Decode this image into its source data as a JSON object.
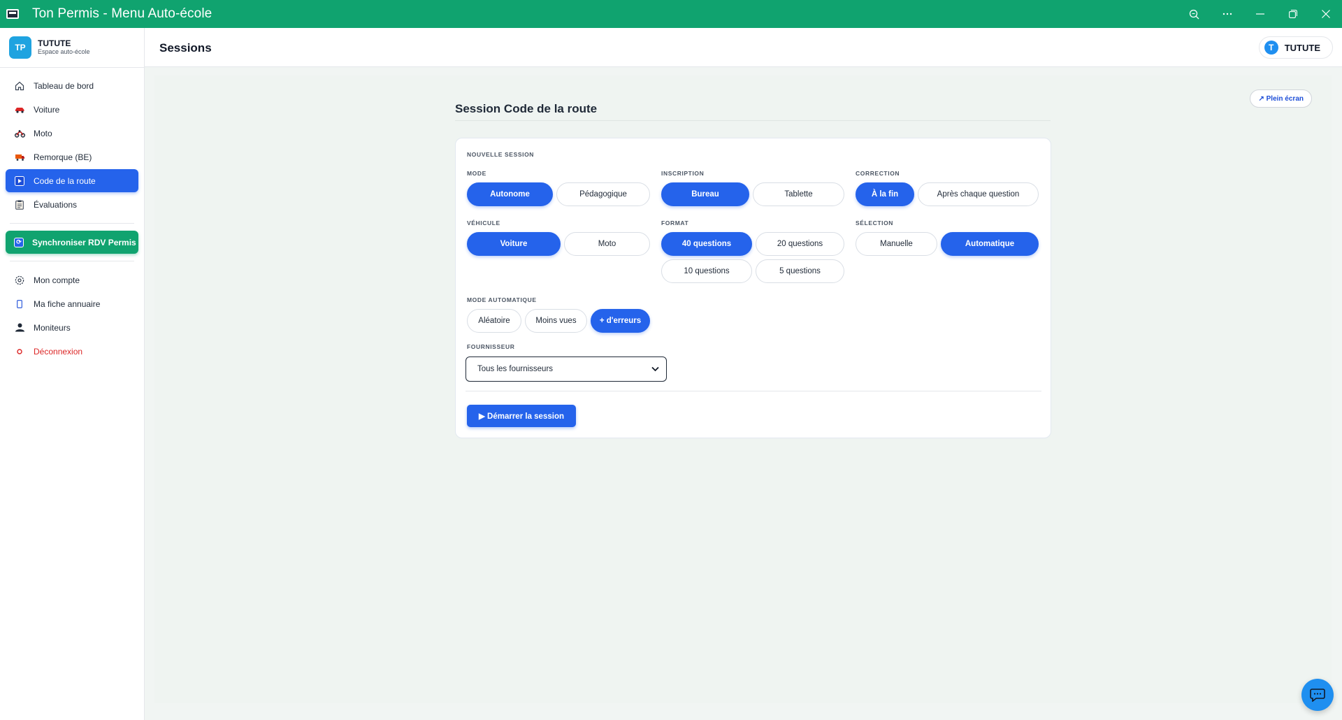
{
  "window": {
    "title": "Ton Permis - Menu Auto-école",
    "controls": [
      "search-icon",
      "more-icon",
      "minimize-icon",
      "restore-icon",
      "close-icon"
    ]
  },
  "brand": {
    "logo": "TP",
    "name": "TUTUTE",
    "subtitle": "Espace auto-école"
  },
  "sidebar": {
    "items": [
      {
        "label": "Tableau de bord",
        "icon": "home-icon"
      },
      {
        "label": "Voiture",
        "icon": "car-icon"
      },
      {
        "label": "Moto",
        "icon": "motorcycle-icon"
      },
      {
        "label": "Remorque (BE)",
        "icon": "truck-icon"
      },
      {
        "label": "Code de la route",
        "icon": "play-icon",
        "active": true
      },
      {
        "label": "Évaluations",
        "icon": "clipboard-icon"
      }
    ],
    "sync_label": "Synchroniser RDV Permis",
    "account_items": [
      {
        "label": "Mon compte",
        "icon": "gear-icon"
      },
      {
        "label": "Ma fiche annuaire",
        "icon": "phone-icon"
      },
      {
        "label": "Moniteurs",
        "icon": "people-icon"
      },
      {
        "label": "Déconnexion",
        "icon": "logout-icon"
      }
    ]
  },
  "header": {
    "title": "Sessions",
    "user_initial": "T",
    "user_name": "TUTUTE"
  },
  "main": {
    "fullscreen_label": "↗ Plein écran",
    "session_title": "Session Code de la route",
    "card": {
      "heading": "NOUVELLE SESSION",
      "mode": {
        "label": "MODE",
        "options": [
          "Autonome",
          "Pédagogique"
        ],
        "selected": "Autonome"
      },
      "inscription": {
        "label": "INSCRIPTION",
        "options": [
          "Bureau",
          "Tablette"
        ],
        "selected": "Bureau"
      },
      "correction": {
        "label": "CORRECTION",
        "options": [
          "À la fin",
          "Après chaque question"
        ],
        "selected": "À la fin"
      },
      "vehicule": {
        "label": "VÉHICULE",
        "options": [
          "Voiture",
          "Moto"
        ],
        "selected": "Voiture"
      },
      "format": {
        "label": "FORMAT",
        "options": [
          "40 questions",
          "20 questions",
          "10 questions",
          "5 questions"
        ],
        "selected": "40 questions"
      },
      "selection": {
        "label": "SÉLECTION",
        "options": [
          "Manuelle",
          "Automatique"
        ],
        "selected": "Automatique"
      },
      "mode_auto": {
        "label": "MODE AUTOMATIQUE",
        "options": [
          "Aléatoire",
          "Moins vues",
          "+ d'erreurs"
        ],
        "selected": "+ d'erreurs"
      },
      "fournisseur": {
        "label": "FOURNISSEUR",
        "value": "Tous les fournisseurs"
      },
      "start_label": "▶ Démarrer la session"
    }
  },
  "colors": {
    "titlebar": "#10a36f",
    "accent": "#2563eb",
    "danger": "#dc2626"
  }
}
